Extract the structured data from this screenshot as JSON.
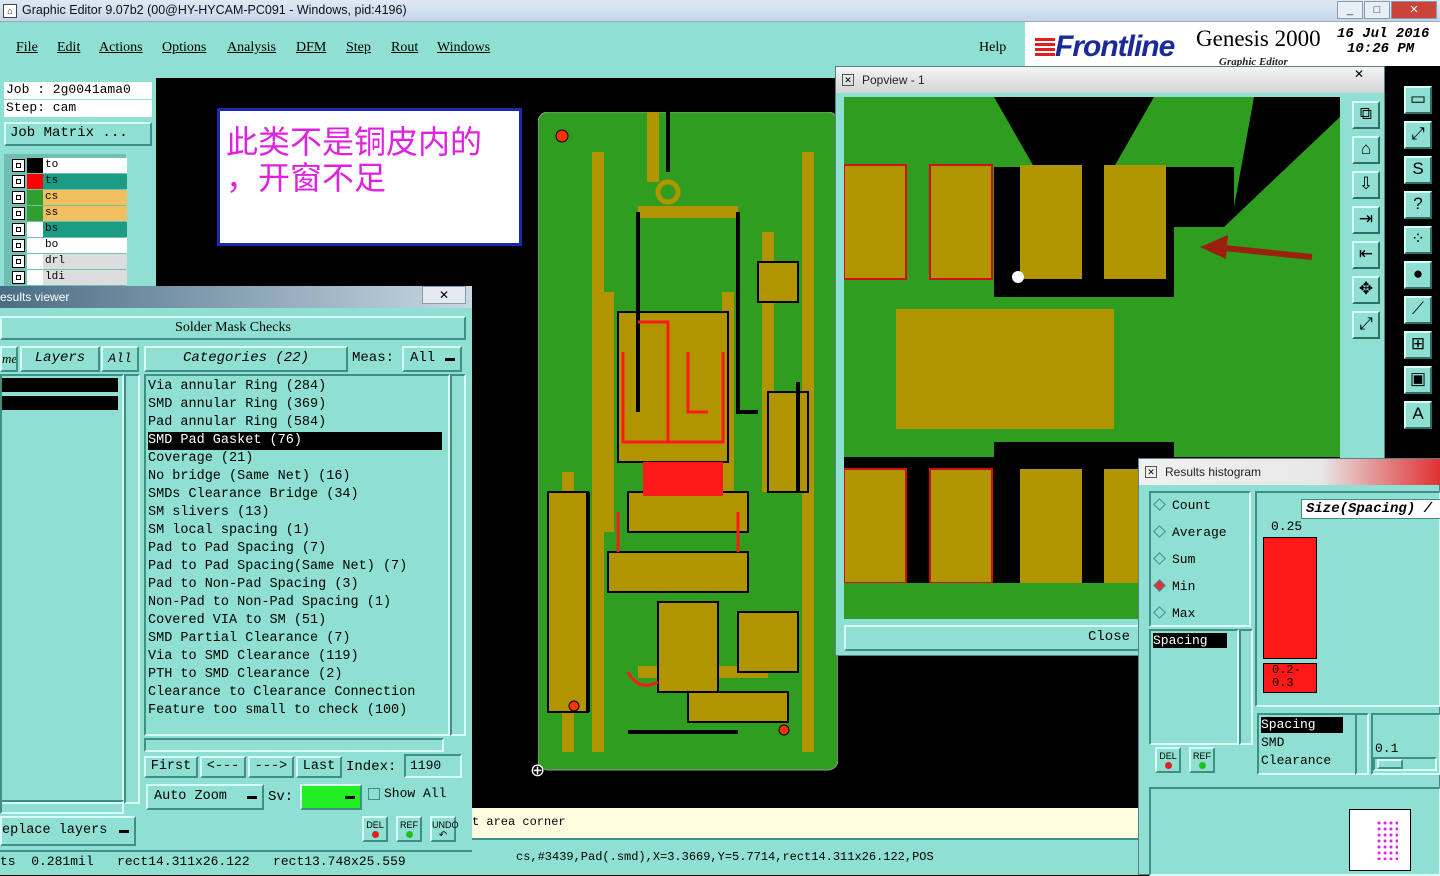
{
  "window": {
    "title": "Graphic Editor 9.07b2 (00@HY-HYCAM-PC091 - Windows, pid:4196)",
    "controls": [
      "_",
      "□",
      "✕"
    ]
  },
  "menu": {
    "items": [
      "File",
      "Edit",
      "Actions",
      "Options",
      "Analysis",
      "DFM",
      "Step",
      "Rout",
      "Windows"
    ],
    "help": "Help"
  },
  "brand": {
    "logo": "Frontline",
    "product": "Genesis 2000",
    "subtitle": "Graphic Editor",
    "date": "16 Jul 2016",
    "time": "10:26 PM"
  },
  "job": {
    "job_label": "Job : 2g0041ama0",
    "step_label": "Step: cam",
    "matrix_button": "Job Matrix ..."
  },
  "layers": [
    {
      "name": "to",
      "color": "#ffffff",
      "mark": "#000000"
    },
    {
      "name": "ts",
      "color": "#1c9c84",
      "mark": "#ff0000"
    },
    {
      "name": "cs",
      "color": "#f0c060",
      "mark": "#2fa02f"
    },
    {
      "name": "ss",
      "color": "#f0c060",
      "mark": "#2fa02f"
    },
    {
      "name": "bs",
      "color": "#1c9c84",
      "mark": "#ffffff"
    },
    {
      "name": "bo",
      "color": "#ffffff",
      "mark": "#ffffff"
    },
    {
      "name": "drl",
      "color": "#dddddd",
      "mark": "#ffffff"
    },
    {
      "name": "ldi",
      "color": "#dddddd",
      "mark": "#ffffff"
    }
  ],
  "annotation": {
    "line1": "此类不是铜皮内的",
    "line2": "，开窗不足"
  },
  "results_viewer": {
    "title": "esults viewer",
    "close": "✕",
    "heading": "Solder Mask Checks",
    "tab_left": "me",
    "tab_layers": "Layers",
    "tab_all": "All",
    "categories_label": "Categories (22)",
    "meas_label": "Meas:",
    "meas_value": "All",
    "categories": [
      "Via annular Ring (284)",
      "SMD annular Ring (369)",
      "Pad annular Ring (584)",
      "SMD Pad Gasket (76)",
      "Coverage (21)",
      "No bridge (Same Net) (16)",
      "SMDs Clearance Bridge (34)",
      "SM slivers (13)",
      "SM local spacing (1)",
      "Pad to Pad Spacing (7)",
      "Pad to Pad Spacing(Same Net) (7)",
      "Pad to Non-Pad Spacing (3)",
      "Non-Pad to Non-Pad Spacing (1)",
      "Covered VIA to SM (51)",
      "SMD Partial Clearance (7)",
      "Via to SMD Clearance (119)",
      "PTH to SMD Clearance (2)",
      "Clearance to Clearance Connection",
      "Feature too small to check (100)"
    ],
    "selected_index": 3,
    "nav": {
      "first": "First",
      "prev": "<---",
      "next": "--->",
      "last": "Last",
      "index_label": "Index:",
      "index_value": "1190"
    },
    "auto_zoom": "Auto Zoom",
    "sv_label": "Sv:",
    "show_all": "Show All",
    "replace_layers": "eplace layers",
    "del": "DEL",
    "ref": "REF",
    "undo": "UNDO"
  },
  "status": {
    "left": "ts  0.281mil   rect14.311x26.122   rect13.748x25.559",
    "prompt": "t area corner",
    "info": "cs,#3439,Pad(.smd),X=3.3669,Y=5.7714,rect14.311x26.122,POS"
  },
  "popview": {
    "title": "Popview - 1",
    "close_x": "✕",
    "close_button": "Close"
  },
  "histogram": {
    "title": "Results histogram",
    "options": [
      "Count",
      "Average",
      "Sum",
      "Min",
      "Max"
    ],
    "selected_option": "Min",
    "size_label": "Size(Spacing) /",
    "top_value": "0.25",
    "bar_label": "0.2-\n0.3",
    "list1": [
      "Spacing"
    ],
    "list2": [
      "Spacing",
      "SMD",
      "Clearance"
    ],
    "value": "0.1",
    "del": "DEL",
    "ref": "REF"
  },
  "colors": {
    "panel": "#8fe0d2",
    "pcb_green": "#2f9e20",
    "pcb_gold": "#b09400",
    "highlight": "#ff1a1a",
    "annotation_text": "#e020e0"
  },
  "toolbar_icons": [
    "window-icon",
    "zoom-fit-icon",
    "s-curve-icon",
    "help-icon",
    "snap-icon",
    "point-icon",
    "measure-icon",
    "frame-icon",
    "layers-icon",
    "text-icon"
  ],
  "popview_tools": [
    "popout-icon",
    "home-icon",
    "save-icon",
    "import-icon",
    "export-icon",
    "zoom-area-icon",
    "zoom-fit-icon"
  ]
}
